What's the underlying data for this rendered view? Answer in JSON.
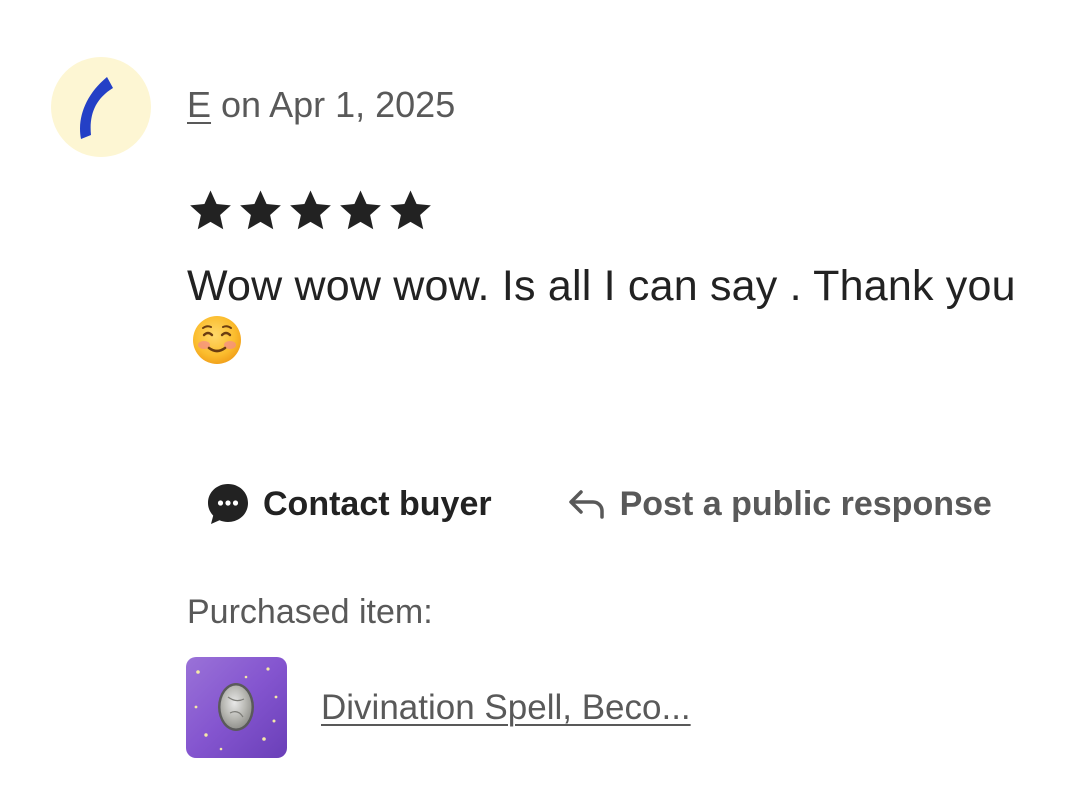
{
  "review": {
    "author": "E",
    "date_text": "on Apr 1, 2025",
    "rating": 5,
    "rating_max": 5,
    "text": "Wow wow wow. Is all I can say . Thank you"
  },
  "actions": {
    "contact_label": "Contact buyer",
    "public_response_label": "Post a public response"
  },
  "purchase": {
    "label": "Purchased item:",
    "item_title": "Divination Spell, Beco..."
  },
  "colors": {
    "avatar_bg": "#fdf6d3",
    "avatar_shape": "#2440c6",
    "text_primary": "#222222",
    "text_secondary": "#595959",
    "star": "#222222"
  },
  "icons": {
    "contact": "chat-bubble-icon",
    "public_response": "reply-arrow-icon",
    "emoji": "smiling-face-icon",
    "star": "star-icon"
  }
}
